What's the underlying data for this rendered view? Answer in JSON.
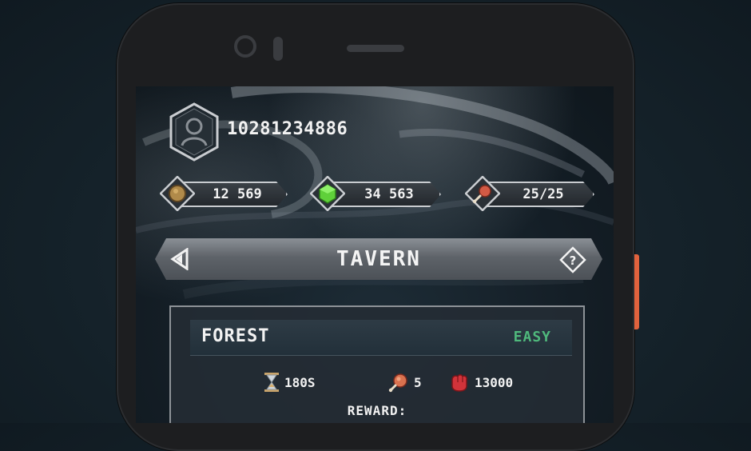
{
  "player": {
    "id": "10281234886"
  },
  "resources": [
    {
      "icon": "coin-icon",
      "value": "12 569"
    },
    {
      "icon": "gem-icon",
      "value": "34 563"
    },
    {
      "icon": "meat-icon",
      "value": "25/25"
    }
  ],
  "nav": {
    "title": "TAVERN"
  },
  "quest": {
    "name": "FOREST",
    "difficulty": "EASY",
    "duration": "180S",
    "food_cost": "5",
    "power": "13000",
    "reward_label": "REWARD:"
  },
  "colors": {
    "accent": "#e0623d",
    "easy": "#4fb87c",
    "gem": "#5fd03a",
    "coin": "#b08a4a"
  }
}
